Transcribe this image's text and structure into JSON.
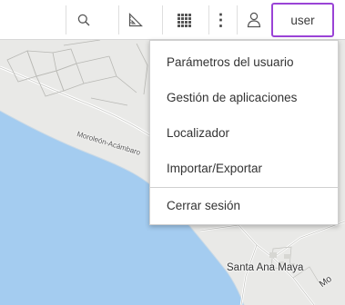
{
  "toolbar": {
    "search_icon": "search-icon",
    "measure_icon": "measure-ruler-icon",
    "apps_icon": "grid-apps-icon",
    "more_glyph": "⋮",
    "user_icon": "user-icon",
    "user_label": "user",
    "accent_color": "#9a43d6"
  },
  "user_menu": {
    "items": [
      {
        "label": "Parámetros del usuario"
      },
      {
        "label": "Gestión de aplicaciones"
      },
      {
        "label": "Localizador"
      },
      {
        "label": "Importar/Exportar"
      },
      {
        "label": "Cerrar sesión"
      }
    ]
  },
  "map": {
    "road_label": "Moroleón-Acámbaro",
    "town_label": "Santa Ana Maya",
    "partial_label": "Mo",
    "water_color": "#a4ccf0",
    "land_color": "#e9e9e7"
  }
}
